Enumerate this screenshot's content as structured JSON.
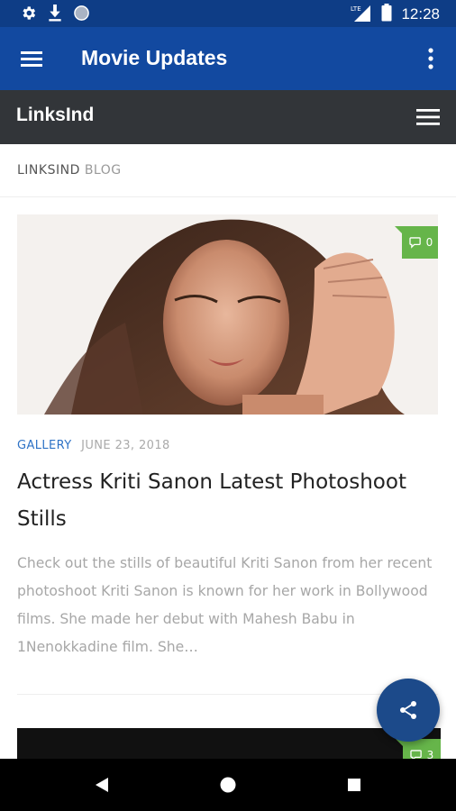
{
  "status_bar": {
    "icons": [
      "settings-icon",
      "download-icon",
      "circle-icon",
      "lte-signal-icon",
      "battery-icon"
    ],
    "network": "LTE",
    "time": "12:28"
  },
  "app_bar": {
    "title": "Movie Updates",
    "menu_icon": "hamburger-icon",
    "more_icon": "more-vert-icon"
  },
  "site_header": {
    "brand": "LinksInd",
    "menu_icon": "hamburger-icon"
  },
  "blog_header": {
    "primary": "LINKSIND",
    "secondary": "BLOG"
  },
  "posts": [
    {
      "comments": "0",
      "category": "GALLERY",
      "date": "JUNE 23, 2018",
      "title": "Actress Kriti Sanon Latest Photoshoot Stills",
      "excerpt": " Check out the stills of beautiful Kriti Sanon from her recent photoshoot Kriti Sanon is known for her work in Bollywood films. She made her debut with Mahesh Babu in 1Nenokkadine film. She…"
    },
    {
      "comments": "3"
    }
  ],
  "fab": {
    "icon": "share-icon"
  },
  "nav_bar": {
    "icons": [
      "back-icon",
      "home-icon",
      "recents-icon"
    ]
  },
  "colors": {
    "status_bar": "#0e3d86",
    "app_bar": "#1249a0",
    "site_header": "#323539",
    "accent_link": "#2f73c6",
    "comment_badge": "#66b54a",
    "fab": "#1c4a8a"
  }
}
